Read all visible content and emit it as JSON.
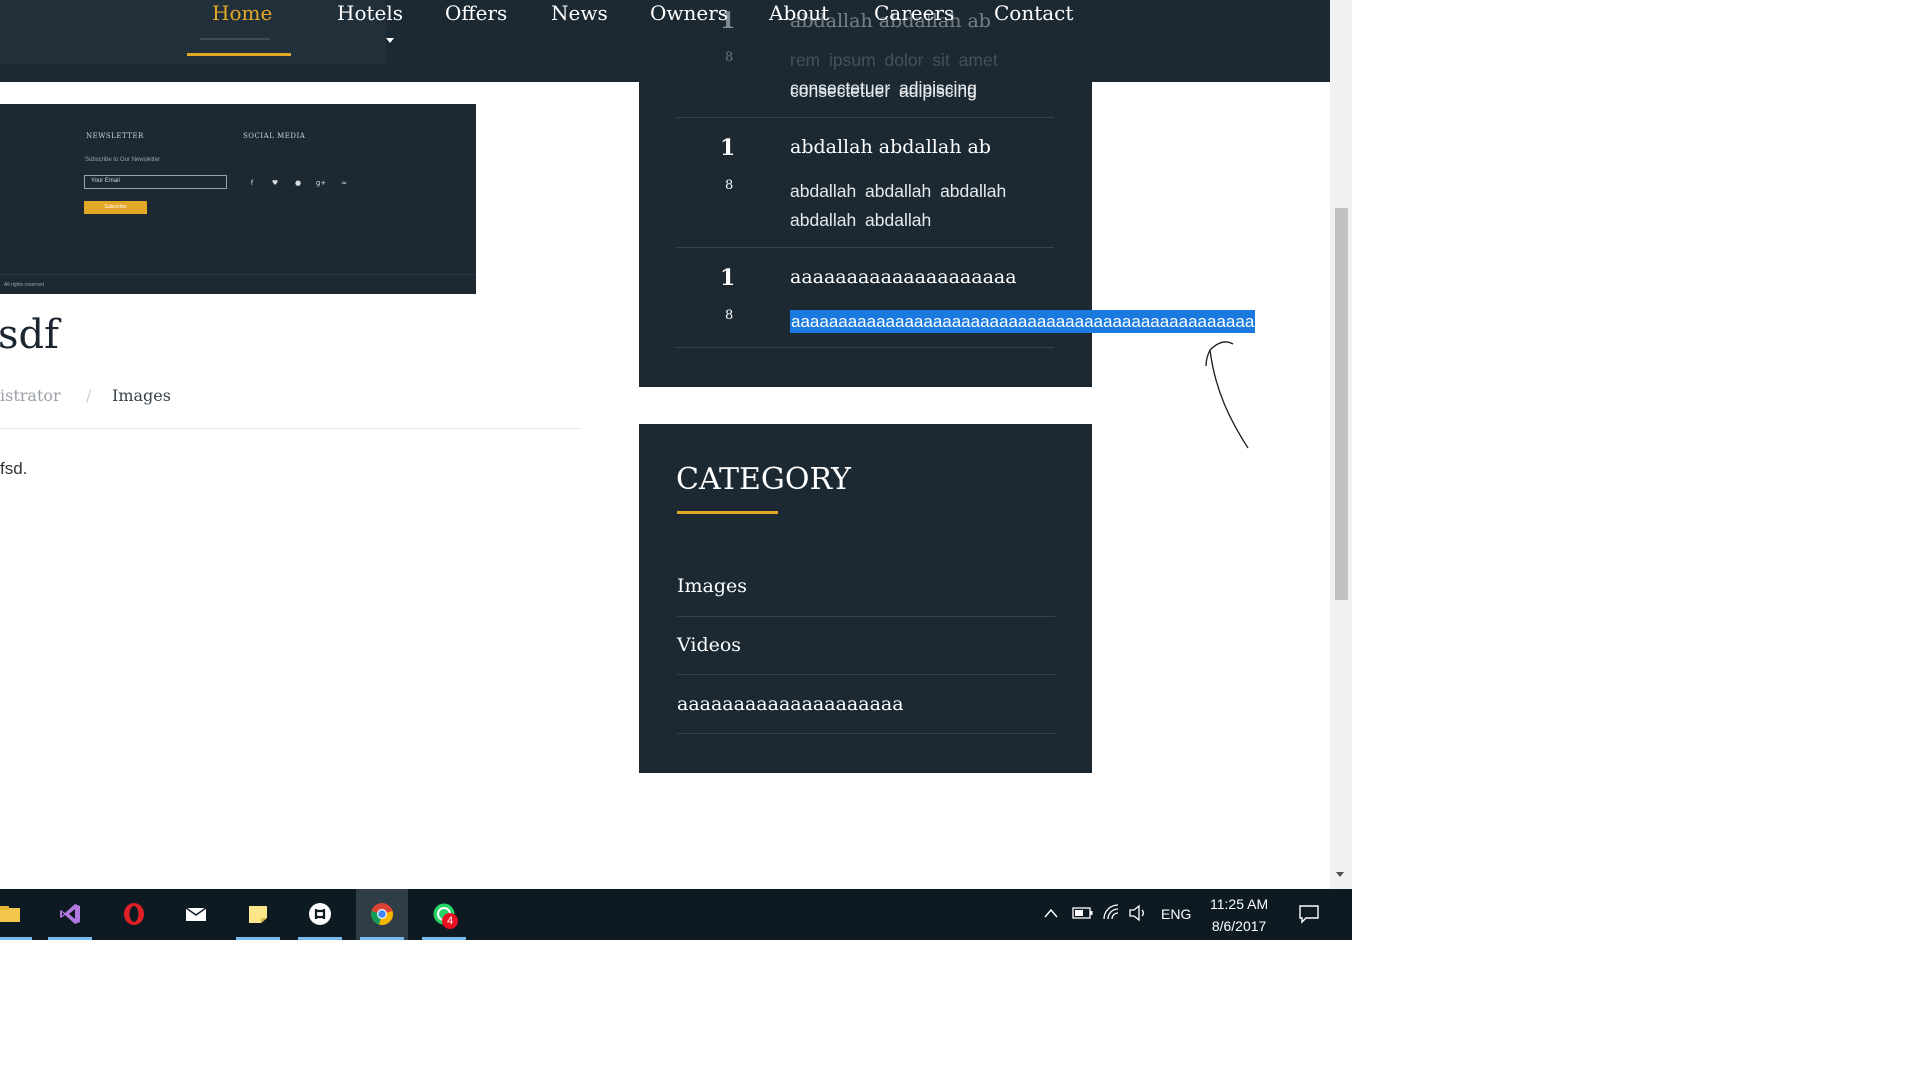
{
  "nav": {
    "items": [
      {
        "label": "Home",
        "active": true
      },
      {
        "label": "Hotels",
        "has_dropdown": true
      },
      {
        "label": "Offers"
      },
      {
        "label": "News"
      },
      {
        "label": "Owners"
      },
      {
        "label": "About"
      },
      {
        "label": "Careers"
      },
      {
        "label": "Contact"
      }
    ],
    "accent_color": "#e3a827"
  },
  "newsletter_image": {
    "newsletter_heading": "NEWSLETTER",
    "subscribe_text": "Subscribe to Our Newsletter",
    "email_placeholder": "Your Email",
    "button_label": "Subscribe",
    "social_heading": "SOCIAL MEDIA",
    "social_icons": [
      "facebook-icon",
      "twitter-icon",
      "skype-icon",
      "google-plus-icon",
      "rss-icon"
    ],
    "footer_text": "All rights reserved"
  },
  "post": {
    "title": "sdf",
    "author": "istrator",
    "separator": "/",
    "category": "Images",
    "body": "fsd."
  },
  "recent_posts": [
    {
      "day": "1",
      "month": "8",
      "title": "abdallah abdallah ab",
      "excerpt": "rem ipsum dolor sit amet consectetuer adipiscing"
    },
    {
      "day": "1",
      "month": "8",
      "title": "abdallah abdallah ab",
      "excerpt": "abdallah abdallah abdallah abdallah abdallah"
    },
    {
      "day": "1",
      "month": "8",
      "title": "aaaaaaaaaaaaaaaaaaaa",
      "excerpt": "aaaaaaaaaaaaaaaaaaaaaaaaaaaaaaaaaaaaaaaaaaaaaaaaa"
    }
  ],
  "category": {
    "heading": "CATEGORY",
    "items": [
      "Images",
      "Videos",
      "aaaaaaaaaaaaaaaaaaaa"
    ]
  },
  "taskbar": {
    "apps": [
      "file-explorer-icon",
      "visual-studio-icon",
      "opera-icon",
      "mail-icon",
      "sticky-notes-icon",
      "slack-icon",
      "chrome-icon",
      "whatsapp-icon"
    ],
    "active_app": "chrome-icon",
    "whatsapp_badge": "4",
    "language": "ENG",
    "time": "11:25 AM",
    "date": "8/6/2017"
  }
}
